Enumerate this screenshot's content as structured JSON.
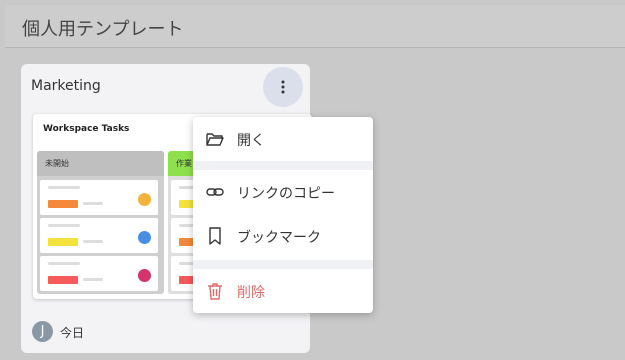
{
  "header": {
    "title": "個人用テンプレート"
  },
  "card": {
    "title": "Marketing",
    "preview": {
      "title": "Workspace Tasks",
      "columns": [
        {
          "label": "未開始"
        },
        {
          "label": "作業"
        }
      ]
    },
    "footer": {
      "avatar_initial": "J",
      "date": "今日"
    }
  },
  "menu": {
    "items": [
      {
        "label": "開く",
        "icon": "folder-open-icon"
      },
      {
        "label": "リンクのコピー",
        "icon": "link-icon"
      },
      {
        "label": "ブックマーク",
        "icon": "bookmark-icon"
      },
      {
        "label": "削除",
        "icon": "trash-icon"
      }
    ]
  },
  "colors": {
    "danger": "#e26a6a",
    "accent": "#dadfeb"
  }
}
